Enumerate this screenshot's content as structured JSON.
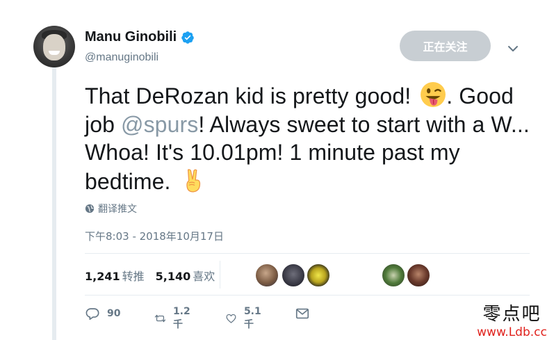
{
  "author": {
    "name": "Manu Ginobili",
    "handle": "@manuginobili",
    "verified_icon": "verified-badge-icon",
    "verified_color": "#1da1f2"
  },
  "follow_button": {
    "label": "正在关注"
  },
  "tweet": {
    "text_part1": "That DeRozan kid is pretty good! ",
    "emoji1": "winking-face-with-tongue-emoji",
    "text_part2": ". Good job ",
    "mention": "@spurs",
    "text_part3": "! Always sweet to start with a W... Whoa! It's 10.01pm! 1 minute past my bedtime. ",
    "emoji2": "victory-hand-emoji"
  },
  "translate": {
    "icon": "globe-icon",
    "label": "翻译推文"
  },
  "timestamp": "下午8:03 - 2018年10月17日",
  "stats": {
    "retweets_count": "1,241",
    "retweets_label": "转推",
    "likes_count": "5,140",
    "likes_label": "喜欢"
  },
  "liker_avatars_count": 5,
  "actions": {
    "reply_count": "90",
    "retweet_count": "1.2千",
    "like_count": "5.1千"
  },
  "watermark": {
    "line1": "零点吧",
    "line2": "www.Ldb.cc"
  },
  "colors": {
    "text": "#14171a",
    "secondary": "#657786",
    "mention": "#8899a6",
    "divider": "#e6ecf0",
    "follow_button_bg": "#c8ced3",
    "watermark_url": "#e0221d"
  }
}
